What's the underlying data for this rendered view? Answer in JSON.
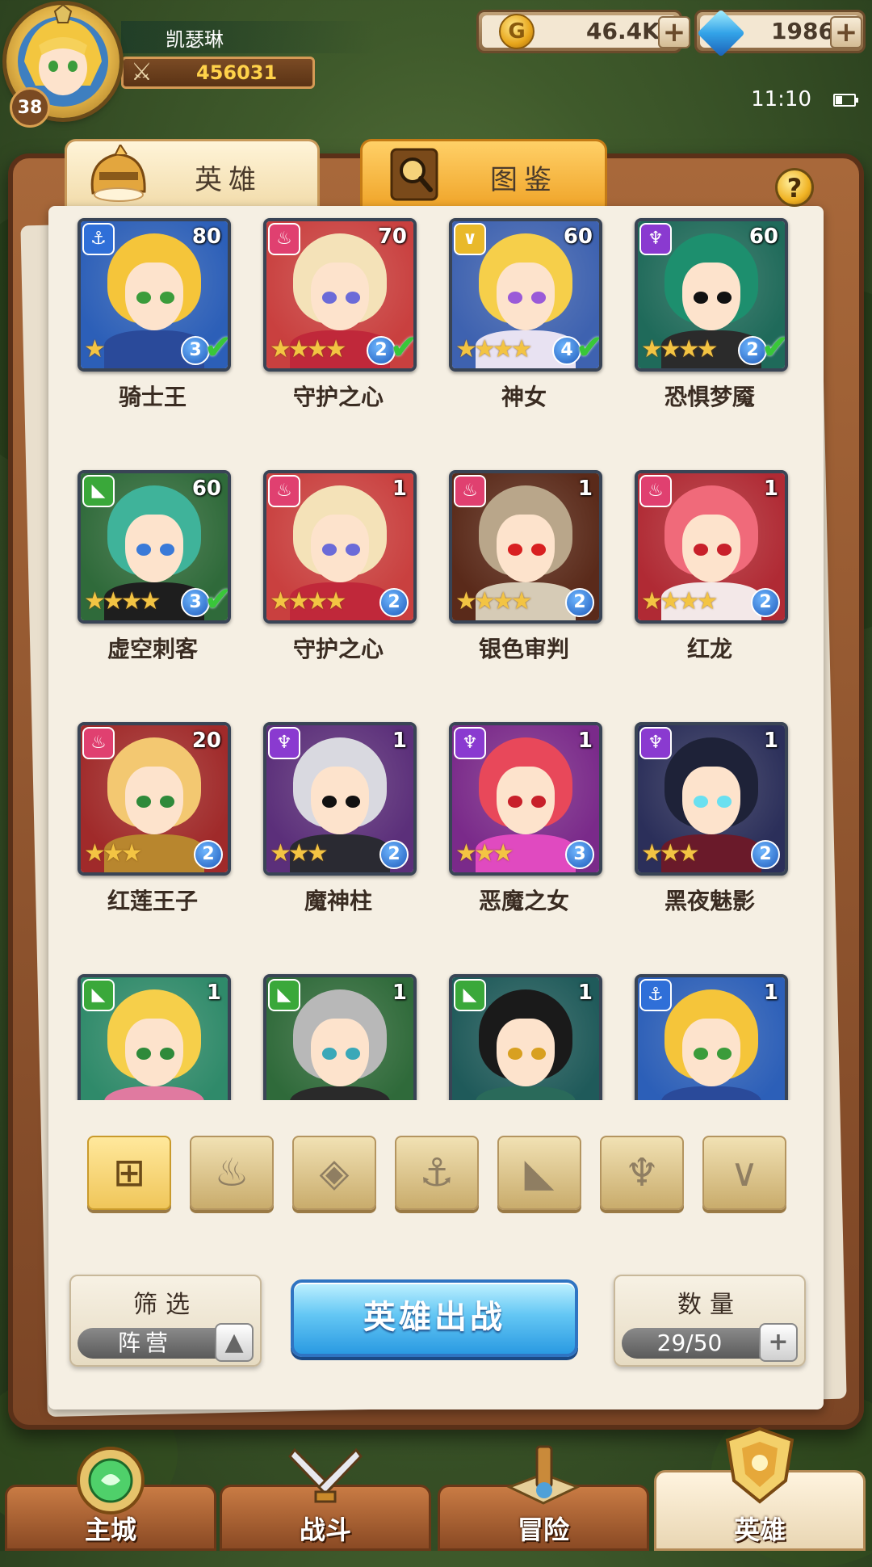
{
  "player": {
    "name": "凯瑟琳",
    "level": "38",
    "power": "456031"
  },
  "resources": {
    "gold": "46.4K",
    "gems": "1986",
    "gold_icon": "gold-coin-icon",
    "gem_icon": "diamond-icon"
  },
  "status": {
    "time": "11:10"
  },
  "tabs": [
    {
      "label": "英雄",
      "icon": "knight-helmet-icon"
    },
    {
      "label": "图鉴",
      "icon": "magnifier-book-icon"
    }
  ],
  "heroes": [
    {
      "name": "骑士王",
      "level": "80",
      "element": "anchor",
      "element_color": "#2f6fd8",
      "stars": 1,
      "rank": "3",
      "deployed": true,
      "bg": "#2c5fb8",
      "hair": "#f5c53a",
      "eye": "#3b9c3b",
      "body": "#2a4a9a"
    },
    {
      "name": "守护之心",
      "level": "70",
      "element": "flame",
      "element_color": "#e04070",
      "stars": 4,
      "rank": "2",
      "deployed": true,
      "bg": "#c9403f",
      "hair": "#f4e2b8",
      "eye": "#6b6bd8",
      "body": "#c0283a"
    },
    {
      "name": "神女",
      "level": "60",
      "element": "chevron",
      "element_color": "#e9b92a",
      "stars": 4,
      "rank": "4",
      "deployed": true,
      "bg": "#3e62b0",
      "hair": "#f6cf4a",
      "eye": "#9a5ad8",
      "body": "#e8e2f2"
    },
    {
      "name": "恐惧梦魇",
      "level": "60",
      "element": "horns",
      "element_color": "#8a3ad0",
      "stars": 4,
      "rank": "2",
      "deployed": true,
      "bg": "#1f6a5a",
      "hair": "#1d8f6e",
      "eye": "#111111",
      "body": "#2b2b2b"
    },
    {
      "name": "虚空刺客",
      "level": "60",
      "element": "beast",
      "element_color": "#3aa83a",
      "stars": 4,
      "rank": "3",
      "deployed": true,
      "bg": "#2f6a3a",
      "hair": "#3fb39a",
      "eye": "#3a7ad8",
      "body": "#1e1e1e"
    },
    {
      "name": "守护之心",
      "level": "1",
      "element": "flame",
      "element_color": "#e04070",
      "stars": 4,
      "rank": "2",
      "deployed": false,
      "bg": "#c9403f",
      "hair": "#f4e2b8",
      "eye": "#6b6bd8",
      "body": "#c0283a"
    },
    {
      "name": "银色审判",
      "level": "1",
      "element": "flame",
      "element_color": "#e04070",
      "stars": 4,
      "rank": "2",
      "deployed": false,
      "bg": "#5a2a1a",
      "hair": "#b9a68a",
      "eye": "#d82020",
      "body": "#d6cbb6"
    },
    {
      "name": "红龙",
      "level": "1",
      "element": "flame",
      "element_color": "#e04070",
      "stars": 4,
      "rank": "2",
      "deployed": false,
      "bg": "#b02a34",
      "hair": "#f06a7a",
      "eye": "#c8202a",
      "body": "#f3e8e8"
    },
    {
      "name": "红莲王子",
      "level": "20",
      "element": "flame",
      "element_color": "#e04070",
      "stars": 3,
      "rank": "2",
      "deployed": false,
      "bg": "#a02a2a",
      "hair": "#f3c871",
      "eye": "#2f8a3a",
      "body": "#b8862e"
    },
    {
      "name": "魔神柱",
      "level": "1",
      "element": "horns",
      "element_color": "#8a3ad0",
      "stars": 3,
      "rank": "2",
      "deployed": false,
      "bg": "#5b2f7a",
      "hair": "#d9d9e0",
      "eye": "#111111",
      "body": "#2a2a32"
    },
    {
      "name": "恶魔之女",
      "level": "1",
      "element": "horns",
      "element_color": "#8a3ad0",
      "stars": 3,
      "rank": "3",
      "deployed": false,
      "bg": "#7a2a8a",
      "hair": "#e8485a",
      "eye": "#c8202a",
      "body": "#e04ac0"
    },
    {
      "name": "黑夜魅影",
      "level": "1",
      "element": "horns",
      "element_color": "#8a3ad0",
      "stars": 3,
      "rank": "2",
      "deployed": false,
      "bg": "#2b2f5a",
      "hair": "#1e2238",
      "eye": "#6ae0f0",
      "body": "#6a1a2a"
    },
    {
      "name": "",
      "level": "1",
      "element": "beast",
      "element_color": "#3aa83a",
      "stars": 0,
      "rank": "",
      "deployed": false,
      "bg": "#2f8a6a",
      "hair": "#f6cf4a",
      "eye": "#2f8a3a",
      "body": "#e07aa0"
    },
    {
      "name": "",
      "level": "1",
      "element": "beast",
      "element_color": "#3aa83a",
      "stars": 0,
      "rank": "",
      "deployed": false,
      "bg": "#2f6a3a",
      "hair": "#b8b8b8",
      "eye": "#3aa8b8",
      "body": "#2a2a2a"
    },
    {
      "name": "",
      "level": "1",
      "element": "beast",
      "element_color": "#3aa83a",
      "stars": 0,
      "rank": "",
      "deployed": false,
      "bg": "#1f5a5a",
      "hair": "#1a1a1a",
      "eye": "#d8a020",
      "body": "#2a6a5a"
    },
    {
      "name": "",
      "level": "1",
      "element": "anchor",
      "element_color": "#2f6fd8",
      "stars": 0,
      "rank": "",
      "deployed": false,
      "bg": "#2c5fb8",
      "hair": "#f5c53a",
      "eye": "#3b9c3b",
      "body": "#2a4a9a"
    }
  ],
  "filters": [
    {
      "icon": "grid-all-icon",
      "glyph": "⊞",
      "active": true
    },
    {
      "icon": "flame-faction-icon",
      "glyph": "♨",
      "active": false
    },
    {
      "icon": "diamond-faction-icon",
      "glyph": "◈",
      "active": false
    },
    {
      "icon": "anchor-faction-icon",
      "glyph": "⚓",
      "active": false
    },
    {
      "icon": "beast-faction-icon",
      "glyph": "◣",
      "active": false
    },
    {
      "icon": "horns-faction-icon",
      "glyph": "♆",
      "active": false
    },
    {
      "icon": "chevron-faction-icon",
      "glyph": "∨",
      "active": false
    }
  ],
  "controls": {
    "filter_title": "筛选",
    "filter_value": "阵营",
    "deploy_label": "英雄出战",
    "count_title": "数量",
    "count_value": "29/50"
  },
  "nav": [
    {
      "label": "主城",
      "icon": "castle-icon",
      "active": false
    },
    {
      "label": "战斗",
      "icon": "crossed-swords-icon",
      "active": false
    },
    {
      "label": "冒险",
      "icon": "map-scroll-icon",
      "active": false
    },
    {
      "label": "英雄",
      "icon": "hero-crest-icon",
      "active": true
    }
  ]
}
